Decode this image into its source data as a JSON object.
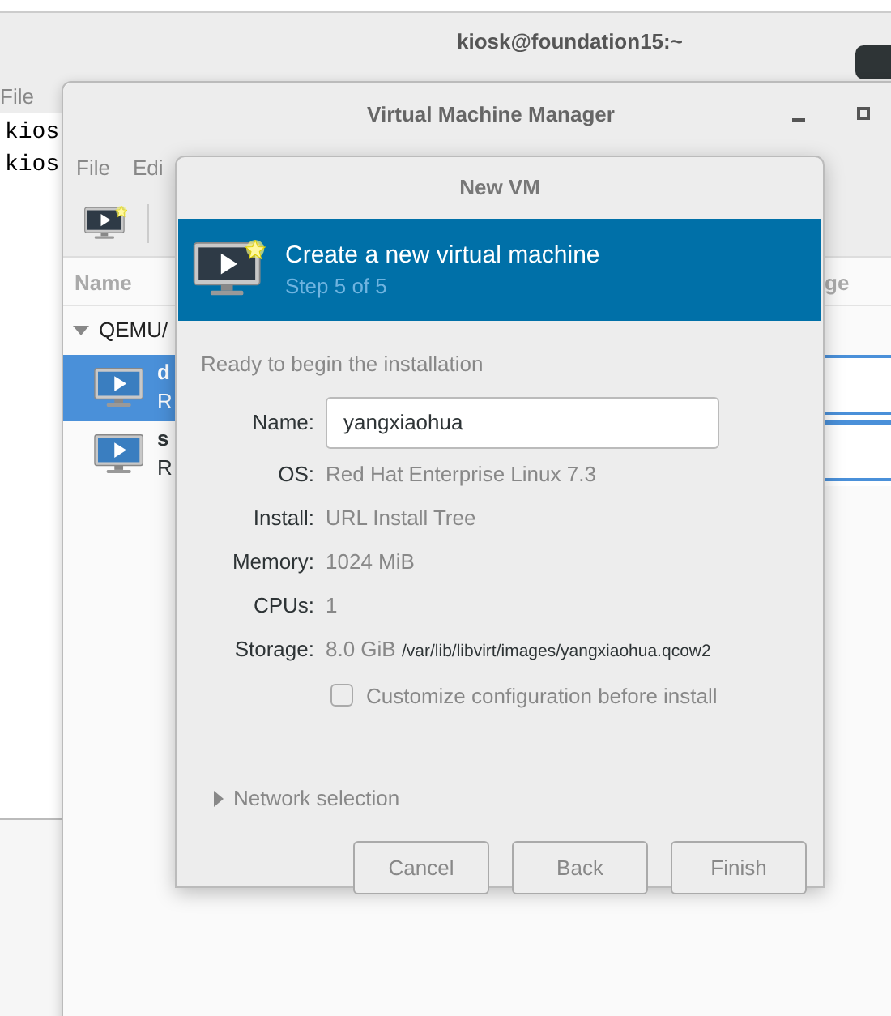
{
  "terminal": {
    "title": "kiosk@foundation15:~",
    "menu": [
      "File"
    ],
    "lines": [
      "kios",
      "kios"
    ]
  },
  "manager": {
    "title": "Virtual Machine Manager",
    "menu": [
      "File",
      "Edi"
    ],
    "columns": [
      "Name",
      "ge"
    ],
    "connection": {
      "label": "QEMU/",
      "expanded": true
    },
    "vms": [
      {
        "name": "d",
        "status": "R",
        "selected": true
      },
      {
        "name": "s",
        "status": "R",
        "selected": false
      }
    ]
  },
  "dialog": {
    "title": "New VM",
    "heading": "Create a new virtual machine",
    "step": "Step 5 of 5",
    "intro": "Ready to begin the installation",
    "name_field": {
      "label": "Name:",
      "value": "yangxiaohua"
    },
    "details": [
      {
        "label": "OS:",
        "value": "Red Hat Enterprise Linux 7.3"
      },
      {
        "label": "Install:",
        "value": "URL Install Tree"
      },
      {
        "label": "Memory:",
        "value": "1024 MiB"
      },
      {
        "label": "CPUs:",
        "value": "1"
      },
      {
        "label": "Storage:",
        "value": "8.0 GiB",
        "path": "/var/lib/libvirt/images/yangxiaohua.qcow2"
      }
    ],
    "customize": {
      "label": "Customize configuration before install",
      "checked": false
    },
    "network": {
      "label": "Network selection",
      "expanded": false
    },
    "buttons": [
      "Cancel",
      "Back",
      "Finish"
    ]
  }
}
